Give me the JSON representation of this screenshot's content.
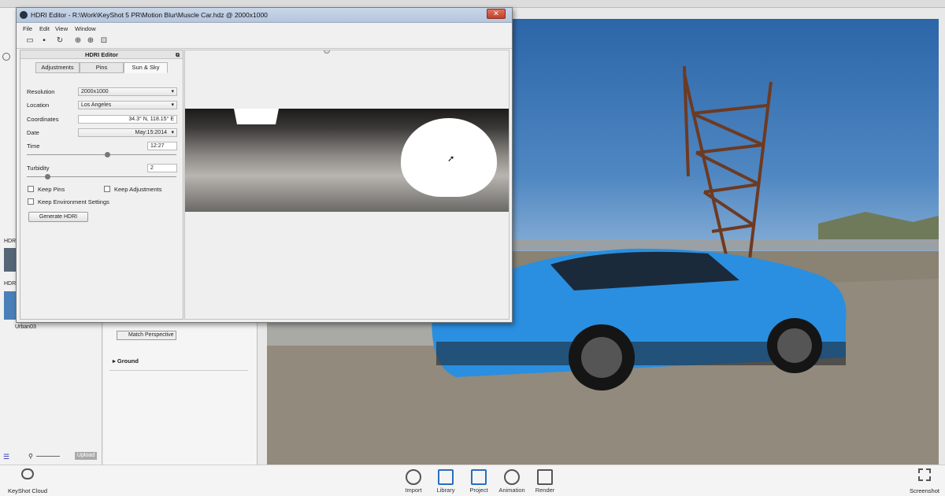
{
  "window": {
    "title": "HDRI Editor - R:\\Work\\KeyShot 5 PR\\Motion Blur\\Muscle Car.hdz @ 2000x1000",
    "close_glyph": "✕"
  },
  "menu": [
    "File",
    "Edit",
    "View",
    "Window"
  ],
  "panel": {
    "title": "HDRI Editor",
    "tabs": [
      "Adjustments",
      "Pins",
      "Sun & Sky"
    ],
    "active_tab": "Sun & Sky",
    "resolution": {
      "label": "Resolution",
      "value": "2000x1000"
    },
    "location": {
      "label": "Location",
      "value": "Los Angeles"
    },
    "coordinates": {
      "label": "Coordinates",
      "value": "34.3° N, 118.15° E"
    },
    "date": {
      "label": "Date",
      "value": "May:15:2014"
    },
    "time": {
      "label": "Time",
      "value": "12:27",
      "level": 0.52
    },
    "turbidity": {
      "label": "Turbidity",
      "value": "2",
      "level": 0.12
    },
    "keep_pins": "Keep Pins",
    "keep_adjustments": "Keep Adjustments",
    "keep_environment": "Keep Environment Settings",
    "generate_button": "Generate HDRI"
  },
  "background": {
    "bottom_tools": [
      "Import",
      "Library",
      "Project",
      "Animation",
      "Render"
    ],
    "keyshot_cloud": "KeyShot Cloud",
    "screenshot": "Screenshot",
    "match_perspective": "Match Perspective",
    "ground": "Ground",
    "thumb_label": "Urban03",
    "upload": "Upload",
    "hdr_label_1": "HDR",
    "hdr_label_2": "HDR"
  },
  "colors": {
    "car_blue": "#2a8fe0",
    "titlebar": "#b8c8de"
  }
}
